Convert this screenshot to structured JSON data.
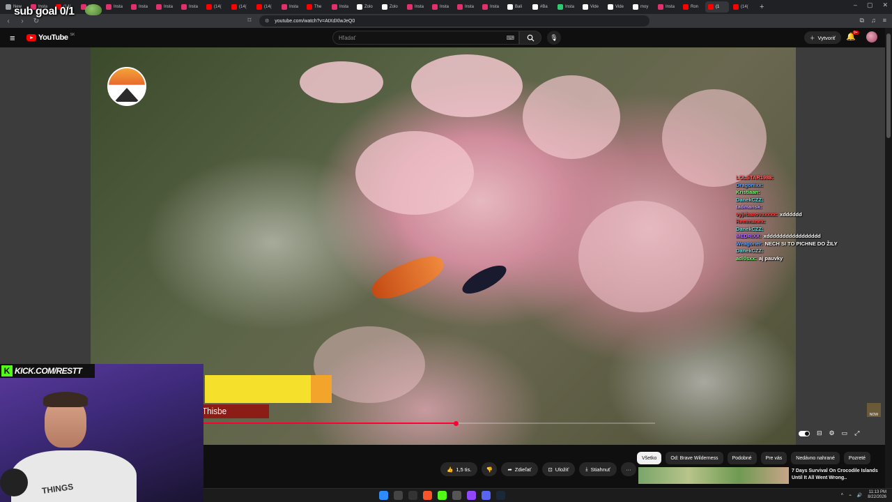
{
  "overlay": {
    "sub_goal": "sub goal 0/1"
  },
  "browser": {
    "tabs": [
      {
        "label": "New",
        "color": "#9aa0a6"
      },
      {
        "label": "Insta",
        "color": "#e1306c"
      },
      {
        "label": "(14(",
        "color": "#ff0000"
      },
      {
        "label": "Insta",
        "color": "#e1306c"
      },
      {
        "label": "Insta",
        "color": "#e1306c"
      },
      {
        "label": "Insta",
        "color": "#e1306c"
      },
      {
        "label": "Insta",
        "color": "#e1306c"
      },
      {
        "label": "Insta",
        "color": "#e1306c"
      },
      {
        "label": "(14(",
        "color": "#ff0000"
      },
      {
        "label": "(14(",
        "color": "#ff0000"
      },
      {
        "label": "(14(",
        "color": "#ff0000"
      },
      {
        "label": "Insta",
        "color": "#e1306c"
      },
      {
        "label": "The",
        "color": "#ff0000"
      },
      {
        "label": "Insta",
        "color": "#e1306c"
      },
      {
        "label": "Zolo",
        "color": "#ffffff"
      },
      {
        "label": "Zolo",
        "color": "#ffffff"
      },
      {
        "label": "Insta",
        "color": "#e1306c"
      },
      {
        "label": "Insta",
        "color": "#e1306c"
      },
      {
        "label": "Insta",
        "color": "#e1306c"
      },
      {
        "label": "Insta",
        "color": "#e1306c"
      },
      {
        "label": "Bali",
        "color": "#ffffff"
      },
      {
        "label": "#Ba",
        "color": "#ffffff"
      },
      {
        "label": "Insta",
        "color": "#2ecc71"
      },
      {
        "label": "Vide",
        "color": "#ffffff"
      },
      {
        "label": "Vide",
        "color": "#ffffff"
      },
      {
        "label": "moy",
        "color": "#ffffff"
      },
      {
        "label": "Insta",
        "color": "#e1306c"
      },
      {
        "label": "Ron",
        "color": "#ff0000"
      },
      {
        "label": "(1",
        "color": "#ff0000",
        "active": true
      },
      {
        "label": "(14(",
        "color": "#ff0000"
      }
    ],
    "url": "youtube.com/watch?v=AtXdXlwJeQ0"
  },
  "youtube": {
    "logo_text": "YouTube",
    "country_code": "SK",
    "search_placeholder": "Hľadať",
    "create_label": "Vytvoriť",
    "notifications_badge": "9+"
  },
  "chat": [
    {
      "user": "LOLSTAR1988:",
      "text": "",
      "color": "#ff6b6b"
    },
    {
      "user": "Dragonixx:",
      "text": "",
      "color": "#5fa8ff"
    },
    {
      "user": "Kristiaan:",
      "text": "",
      "color": "#7cff7c"
    },
    {
      "user": "DanekCZZ:",
      "text": "",
      "color": "#6ad8d8"
    },
    {
      "user": "tadmansk:",
      "text": "",
      "color": "#c8a0ff"
    },
    {
      "user": "vyjebanovaxxxx:",
      "text": "xdddddd",
      "color": "#ff4040"
    },
    {
      "user": "Remmanex:",
      "text": "",
      "color": "#ff4040"
    },
    {
      "user": "DanekCZZ:",
      "text": "",
      "color": "#6ad8d8"
    },
    {
      "user": "MEDRIXX:",
      "text": "xddddddddddddddddd",
      "color": "#b070ff"
    },
    {
      "user": "Weagoner:",
      "text": "NECH SI TO PICHNE DO ŽILY",
      "color": "#5fa8ff"
    },
    {
      "user": "DanekCZZ:",
      "text": "",
      "color": "#6ad8d8"
    },
    {
      "user": "adl0sxx:",
      "text": "aj pauvky",
      "color": "#7cff7c"
    }
  ],
  "video": {
    "name_lower_third": "Thisbe",
    "progress_percent": 56,
    "watermark": "NOW"
  },
  "webcam": {
    "kick_label": "KICK.COM/RESTT",
    "shirt_text": "THINGS"
  },
  "actions": {
    "likes": "1,5 tis.",
    "share": "Zdieľať",
    "save": "Uložiť",
    "download": "Stiahnuť",
    "more": "···"
  },
  "chips": [
    {
      "label": "Všetko",
      "active": true
    },
    {
      "label": "Od: Brave Wilderness"
    },
    {
      "label": "Podobné"
    },
    {
      "label": "Pre vás"
    },
    {
      "label": "Nedávno nahrané"
    },
    {
      "label": "Pozreté"
    }
  ],
  "recommendation": {
    "title": "7 Days Survival On Crocodile Islands Until It All Went Wrong.."
  },
  "taskbar": {
    "time": "11:13 PM",
    "date": "8/22/2026"
  }
}
